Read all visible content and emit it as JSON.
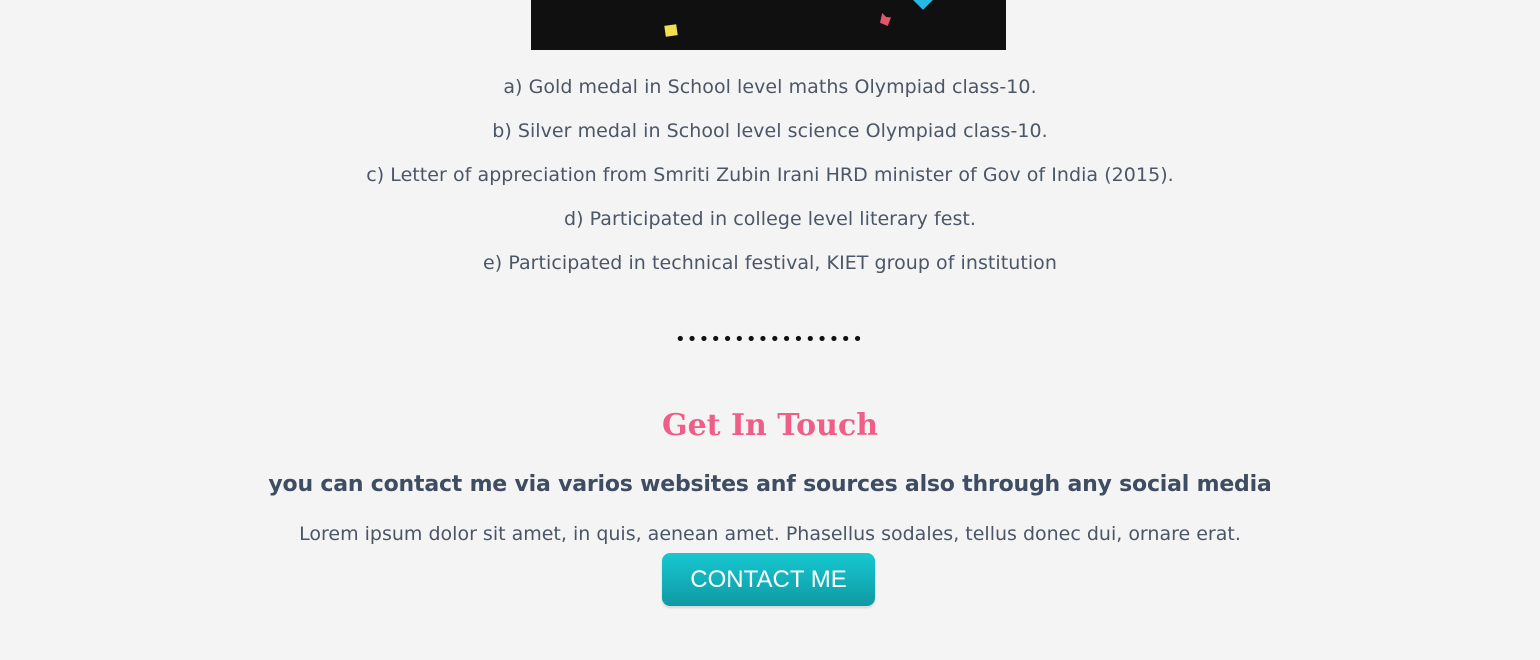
{
  "achievements": [
    "a) Gold medal in School level maths Olympiad class-10.",
    "b) Silver medal in School level science Olympiad class-10.",
    "c) Letter of appreciation from Smriti Zubin Irani HRD minister of Gov of India (2015).",
    "d) Participated in college level literary fest.",
    "e) Participated in technical festival, KIET group of institution"
  ],
  "separator": "••••••••••••••••",
  "contact": {
    "title": "Get In Touch",
    "subtitle": "you can contact me via varios websites anf sources also through any social media",
    "text": "Lorem ipsum dolor sit amet, in quis, aenean amet. Phasellus sodales, tellus donec dui, ornare erat.",
    "button_label": "CONTACT ME"
  },
  "colors": {
    "background": "#f4f4f4",
    "title": "#ef5e87",
    "button": "#17c8d1",
    "text": "#4a5566"
  },
  "icons": {
    "image_confetti": [
      "yellow-confetti-icon",
      "red-confetti-icon",
      "blue-confetti-icon"
    ]
  }
}
